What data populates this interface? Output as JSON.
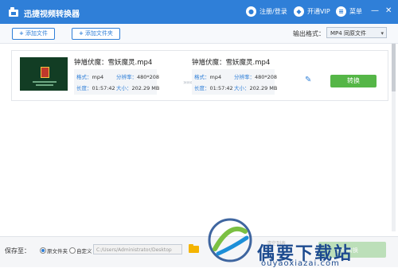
{
  "app": {
    "title": "迅捷视频转换器"
  },
  "titlebar": {
    "login_label": "注册/登录",
    "vip_label": "开通VIP",
    "menu_label": "菜单",
    "minimize": "—",
    "close": "✕"
  },
  "toolbar": {
    "add_file_label": "添加文件",
    "add_folder_label": "添加文件夹",
    "format_label": "输出格式：",
    "format_value": "MP4  同原文件"
  },
  "file": {
    "source_name": "钟馗伏魔：雪妖魔灵.mp4",
    "target_name": "钟馗伏魔：雪妖魔灵.mp4",
    "source": {
      "format_label": "格式：",
      "format": "mp4",
      "resolution_label": "分辨率：",
      "resolution": "480*208",
      "duration_label": "长度：",
      "duration": "01:57:42",
      "size_label": "大小：",
      "size": "202.29 MB"
    },
    "target": {
      "format_label": "格式：",
      "format": "mp4",
      "resolution_label": "分辨率：",
      "resolution": "480*208",
      "duration_label": "长度：",
      "duration": "01:57:42",
      "size_label": "大小：",
      "size": "202.29 MB"
    },
    "arrow": "»»»",
    "convert_label": "转换"
  },
  "bottom": {
    "save_to_label": "保存至：",
    "option_original": "原文件夹",
    "option_custom": "自定义",
    "path": "C:/Users/Administrator/Desktop",
    "clear_list_label": "清空列表",
    "convert_all_label": "全部转换"
  },
  "watermark": {
    "text": "偶要下载站",
    "sub": "ouyaoxiazai.com"
  },
  "colors": {
    "brand": "#2f7fd8",
    "convert": "#55b647",
    "folder": "#f4b400"
  },
  "icons": [
    "logo-icon",
    "user-icon",
    "vip-icon",
    "menu-icon",
    "plus-icon",
    "arrow-icon",
    "edit-icon",
    "folder-icon",
    "radio-icon"
  ]
}
